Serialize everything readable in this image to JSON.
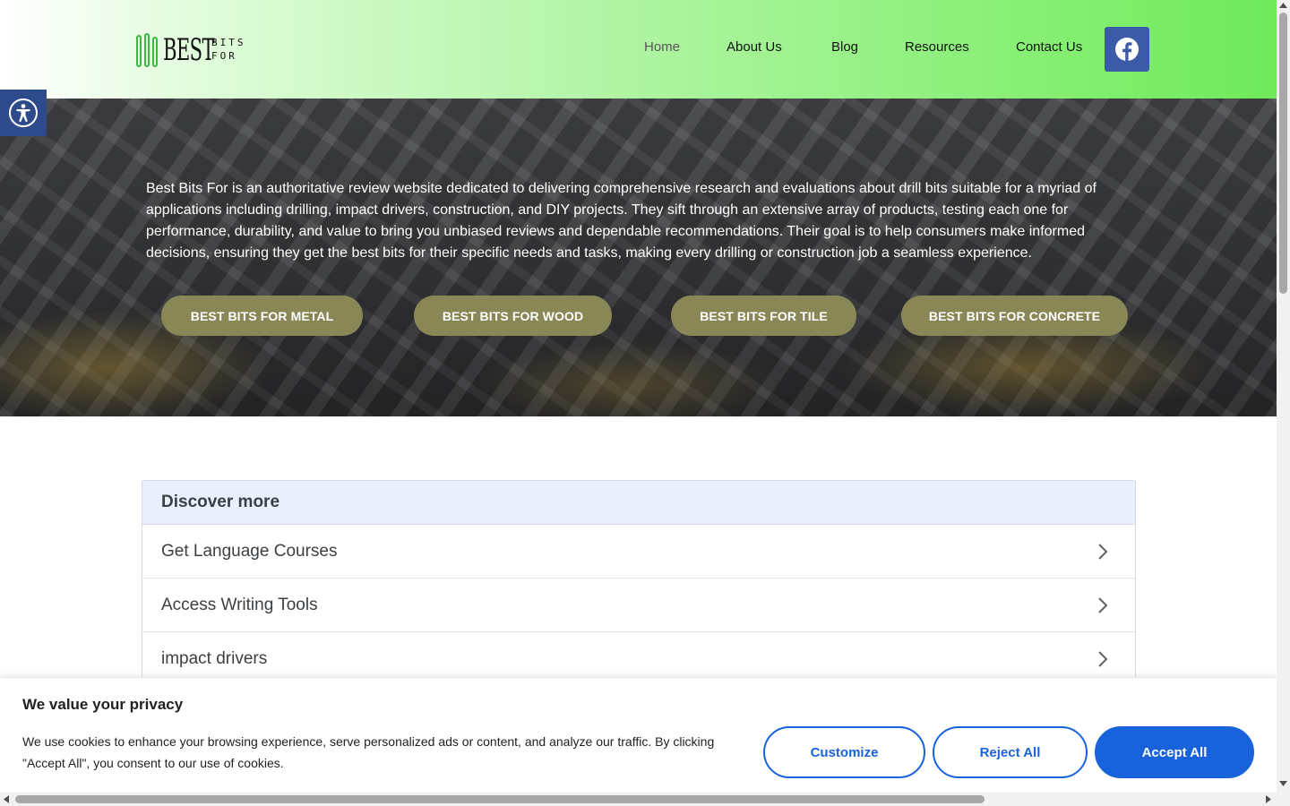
{
  "logo": {
    "word": "BEST",
    "small_line1": "BITS",
    "small_line2": "FOR",
    "accent_color": "#3db83d"
  },
  "nav": {
    "items": [
      {
        "label": "Home",
        "active": true
      },
      {
        "label": "About Us"
      },
      {
        "label": "Blog"
      },
      {
        "label": "Resources"
      },
      {
        "label": "Contact Us"
      }
    ],
    "facebook_icon": "facebook-icon"
  },
  "accessibility": {
    "icon": "accessibility-icon"
  },
  "hero": {
    "description": "Best Bits For is an authoritative review website dedicated to delivering comprehensive research and evaluations about drill bits suitable for a myriad of applications including drilling, impact drivers, construction, and DIY projects. They sift through an extensive array of products, testing each one for performance, durability, and value to bring you unbiased reviews and dependable recommendations. Their goal is to help consumers make informed decisions, ensuring they get the best bits for their specific needs and tasks, making every drilling or construction job a seamless experience.",
    "buttons": [
      "BEST BITS FOR METAL",
      "BEST BITS FOR WOOD",
      "BEST BITS FOR TILE",
      "BEST BITS FOR CONCRETE"
    ],
    "button_color": "#8a8757"
  },
  "discover": {
    "title": "Discover more",
    "items": [
      "Get Language Courses",
      "Access Writing Tools",
      "impact drivers"
    ]
  },
  "cookie": {
    "title": "We value your privacy",
    "text": "We use cookies to enhance your browsing experience, serve personalized ads or content, and analyze our traffic. By clicking \"Accept All\", you consent to our use of cookies.",
    "customize": "Customize",
    "reject": "Reject All",
    "accept": "Accept All",
    "accent_color": "#1863dc"
  }
}
